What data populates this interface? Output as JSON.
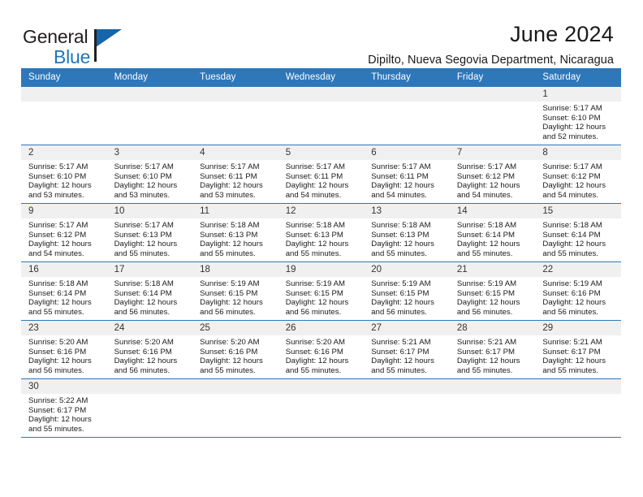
{
  "brand": {
    "line1": "General",
    "line2": "Blue",
    "triangle_color": "#1565ab",
    "blue_text_color": "#1f76bc"
  },
  "header": {
    "title": "June 2024",
    "subtitle": "Dipilto, Nueva Segovia Department, Nicaragua"
  },
  "theme": {
    "header_blue": "#2e77b9",
    "daynum_band": "#f0f0f0",
    "text": "#1a1a1a"
  },
  "calendar": {
    "weekday_headers": [
      "Sunday",
      "Monday",
      "Tuesday",
      "Wednesday",
      "Thursday",
      "Friday",
      "Saturday"
    ],
    "labels": {
      "sunrise": "Sunrise:",
      "sunset": "Sunset:",
      "daylight": "Daylight:"
    },
    "weeks": [
      [
        {
          "day": "",
          "empty": true
        },
        {
          "day": "",
          "empty": true
        },
        {
          "day": "",
          "empty": true
        },
        {
          "day": "",
          "empty": true
        },
        {
          "day": "",
          "empty": true
        },
        {
          "day": "",
          "empty": true
        },
        {
          "day": "1",
          "sunrise": "Sunrise: 5:17 AM",
          "sunset": "Sunset: 6:10 PM",
          "daylight1": "Daylight: 12 hours",
          "daylight2": "and 52 minutes."
        }
      ],
      [
        {
          "day": "2",
          "sunrise": "Sunrise: 5:17 AM",
          "sunset": "Sunset: 6:10 PM",
          "daylight1": "Daylight: 12 hours",
          "daylight2": "and 53 minutes."
        },
        {
          "day": "3",
          "sunrise": "Sunrise: 5:17 AM",
          "sunset": "Sunset: 6:10 PM",
          "daylight1": "Daylight: 12 hours",
          "daylight2": "and 53 minutes."
        },
        {
          "day": "4",
          "sunrise": "Sunrise: 5:17 AM",
          "sunset": "Sunset: 6:11 PM",
          "daylight1": "Daylight: 12 hours",
          "daylight2": "and 53 minutes."
        },
        {
          "day": "5",
          "sunrise": "Sunrise: 5:17 AM",
          "sunset": "Sunset: 6:11 PM",
          "daylight1": "Daylight: 12 hours",
          "daylight2": "and 54 minutes."
        },
        {
          "day": "6",
          "sunrise": "Sunrise: 5:17 AM",
          "sunset": "Sunset: 6:11 PM",
          "daylight1": "Daylight: 12 hours",
          "daylight2": "and 54 minutes."
        },
        {
          "day": "7",
          "sunrise": "Sunrise: 5:17 AM",
          "sunset": "Sunset: 6:12 PM",
          "daylight1": "Daylight: 12 hours",
          "daylight2": "and 54 minutes."
        },
        {
          "day": "8",
          "sunrise": "Sunrise: 5:17 AM",
          "sunset": "Sunset: 6:12 PM",
          "daylight1": "Daylight: 12 hours",
          "daylight2": "and 54 minutes."
        }
      ],
      [
        {
          "day": "9",
          "sunrise": "Sunrise: 5:17 AM",
          "sunset": "Sunset: 6:12 PM",
          "daylight1": "Daylight: 12 hours",
          "daylight2": "and 54 minutes."
        },
        {
          "day": "10",
          "sunrise": "Sunrise: 5:17 AM",
          "sunset": "Sunset: 6:13 PM",
          "daylight1": "Daylight: 12 hours",
          "daylight2": "and 55 minutes."
        },
        {
          "day": "11",
          "sunrise": "Sunrise: 5:18 AM",
          "sunset": "Sunset: 6:13 PM",
          "daylight1": "Daylight: 12 hours",
          "daylight2": "and 55 minutes."
        },
        {
          "day": "12",
          "sunrise": "Sunrise: 5:18 AM",
          "sunset": "Sunset: 6:13 PM",
          "daylight1": "Daylight: 12 hours",
          "daylight2": "and 55 minutes."
        },
        {
          "day": "13",
          "sunrise": "Sunrise: 5:18 AM",
          "sunset": "Sunset: 6:13 PM",
          "daylight1": "Daylight: 12 hours",
          "daylight2": "and 55 minutes."
        },
        {
          "day": "14",
          "sunrise": "Sunrise: 5:18 AM",
          "sunset": "Sunset: 6:14 PM",
          "daylight1": "Daylight: 12 hours",
          "daylight2": "and 55 minutes."
        },
        {
          "day": "15",
          "sunrise": "Sunrise: 5:18 AM",
          "sunset": "Sunset: 6:14 PM",
          "daylight1": "Daylight: 12 hours",
          "daylight2": "and 55 minutes."
        }
      ],
      [
        {
          "day": "16",
          "sunrise": "Sunrise: 5:18 AM",
          "sunset": "Sunset: 6:14 PM",
          "daylight1": "Daylight: 12 hours",
          "daylight2": "and 55 minutes."
        },
        {
          "day": "17",
          "sunrise": "Sunrise: 5:18 AM",
          "sunset": "Sunset: 6:14 PM",
          "daylight1": "Daylight: 12 hours",
          "daylight2": "and 56 minutes."
        },
        {
          "day": "18",
          "sunrise": "Sunrise: 5:19 AM",
          "sunset": "Sunset: 6:15 PM",
          "daylight1": "Daylight: 12 hours",
          "daylight2": "and 56 minutes."
        },
        {
          "day": "19",
          "sunrise": "Sunrise: 5:19 AM",
          "sunset": "Sunset: 6:15 PM",
          "daylight1": "Daylight: 12 hours",
          "daylight2": "and 56 minutes."
        },
        {
          "day": "20",
          "sunrise": "Sunrise: 5:19 AM",
          "sunset": "Sunset: 6:15 PM",
          "daylight1": "Daylight: 12 hours",
          "daylight2": "and 56 minutes."
        },
        {
          "day": "21",
          "sunrise": "Sunrise: 5:19 AM",
          "sunset": "Sunset: 6:15 PM",
          "daylight1": "Daylight: 12 hours",
          "daylight2": "and 56 minutes."
        },
        {
          "day": "22",
          "sunrise": "Sunrise: 5:19 AM",
          "sunset": "Sunset: 6:16 PM",
          "daylight1": "Daylight: 12 hours",
          "daylight2": "and 56 minutes."
        }
      ],
      [
        {
          "day": "23",
          "sunrise": "Sunrise: 5:20 AM",
          "sunset": "Sunset: 6:16 PM",
          "daylight1": "Daylight: 12 hours",
          "daylight2": "and 56 minutes."
        },
        {
          "day": "24",
          "sunrise": "Sunrise: 5:20 AM",
          "sunset": "Sunset: 6:16 PM",
          "daylight1": "Daylight: 12 hours",
          "daylight2": "and 56 minutes."
        },
        {
          "day": "25",
          "sunrise": "Sunrise: 5:20 AM",
          "sunset": "Sunset: 6:16 PM",
          "daylight1": "Daylight: 12 hours",
          "daylight2": "and 55 minutes."
        },
        {
          "day": "26",
          "sunrise": "Sunrise: 5:20 AM",
          "sunset": "Sunset: 6:16 PM",
          "daylight1": "Daylight: 12 hours",
          "daylight2": "and 55 minutes."
        },
        {
          "day": "27",
          "sunrise": "Sunrise: 5:21 AM",
          "sunset": "Sunset: 6:17 PM",
          "daylight1": "Daylight: 12 hours",
          "daylight2": "and 55 minutes."
        },
        {
          "day": "28",
          "sunrise": "Sunrise: 5:21 AM",
          "sunset": "Sunset: 6:17 PM",
          "daylight1": "Daylight: 12 hours",
          "daylight2": "and 55 minutes."
        },
        {
          "day": "29",
          "sunrise": "Sunrise: 5:21 AM",
          "sunset": "Sunset: 6:17 PM",
          "daylight1": "Daylight: 12 hours",
          "daylight2": "and 55 minutes."
        }
      ],
      [
        {
          "day": "30",
          "sunrise": "Sunrise: 5:22 AM",
          "sunset": "Sunset: 6:17 PM",
          "daylight1": "Daylight: 12 hours",
          "daylight2": "and 55 minutes."
        },
        {
          "day": "",
          "empty": true
        },
        {
          "day": "",
          "empty": true
        },
        {
          "day": "",
          "empty": true
        },
        {
          "day": "",
          "empty": true
        },
        {
          "day": "",
          "empty": true
        },
        {
          "day": "",
          "empty": true
        }
      ]
    ]
  }
}
